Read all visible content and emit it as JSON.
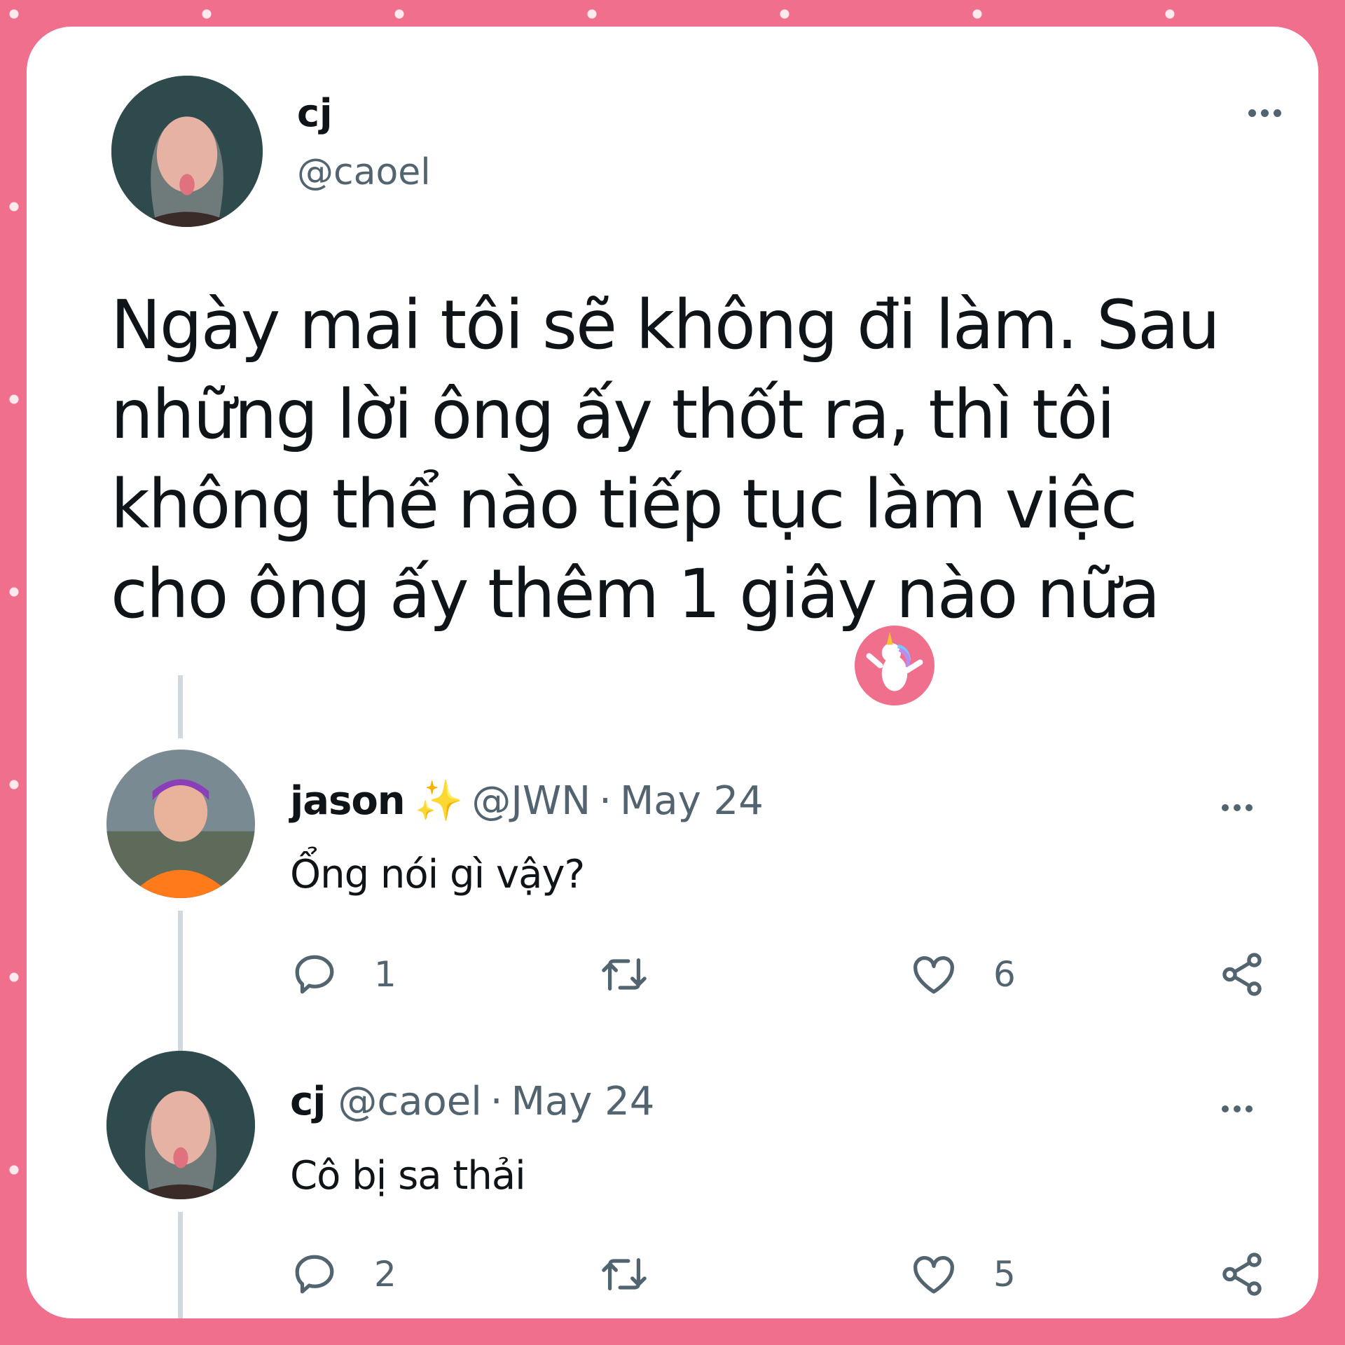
{
  "main_tweet": {
    "name": "cj",
    "handle": "@caoel",
    "text": "Ngày mai tôi sẽ không đi làm. Sau những lời ông ấy thốt ra, thì tôi không thể nào tiếp tục làm việc cho ông ấy thêm 1 giây nào nữa"
  },
  "replies": [
    {
      "name": "jason",
      "emoji": "✨",
      "handle": "@JWN",
      "separator": "·",
      "date": "May 24",
      "text": "Ổng nói gì vậy?",
      "reply_count": "1",
      "like_count": "6"
    },
    {
      "name": "cj",
      "handle": "@caoel",
      "separator": "·",
      "date": "May 24",
      "text": "Cô bị sa thải",
      "reply_count": "2",
      "like_count": "5"
    }
  ],
  "colors": {
    "background": "#ef6f8c",
    "card": "#ffffff",
    "text": "#0f1419",
    "secondary": "#536471",
    "thread_line": "#cfd9de"
  },
  "icons": [
    "more-icon",
    "reply-icon",
    "retweet-icon",
    "like-icon",
    "share-icon",
    "sparkles-emoji",
    "unicorn-sticker"
  ]
}
